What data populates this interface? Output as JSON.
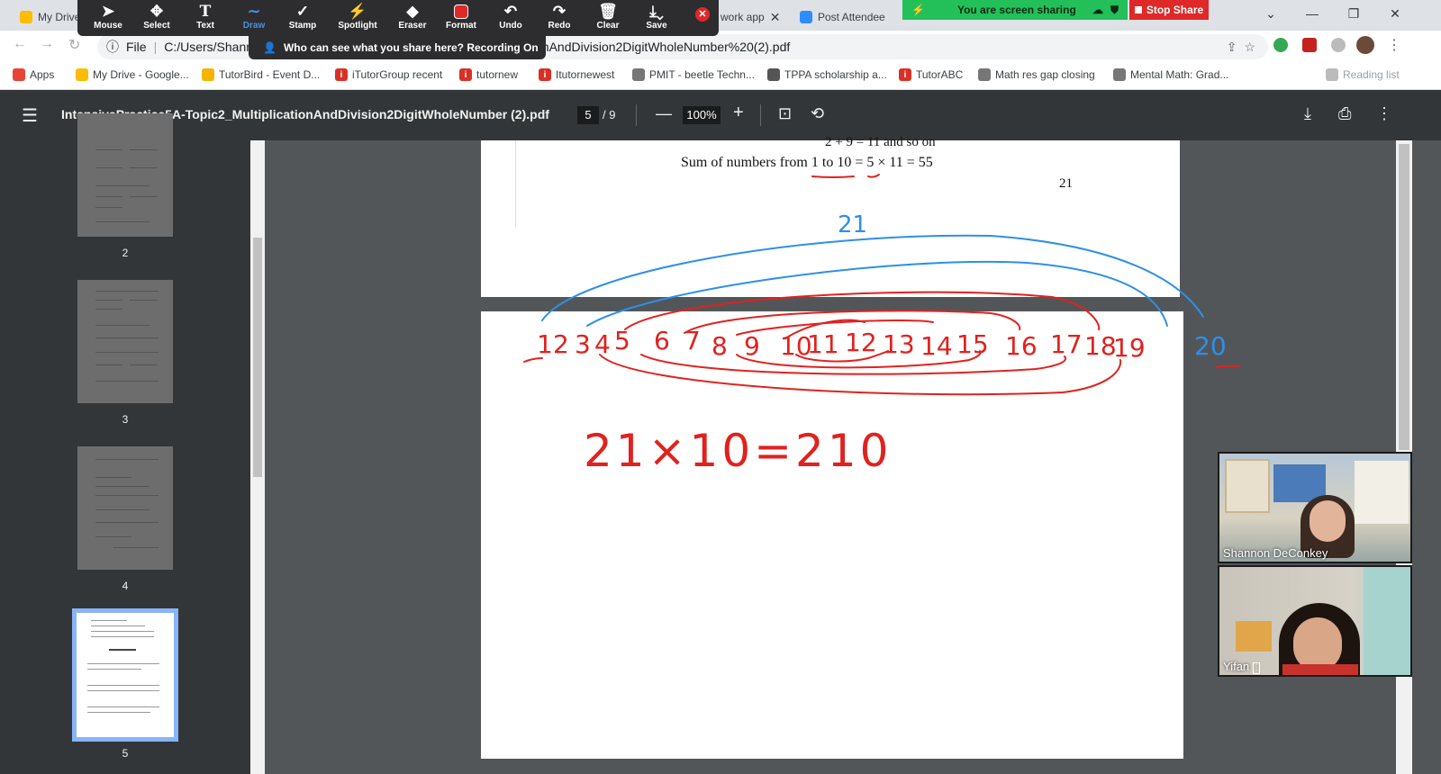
{
  "browser": {
    "tabs": [
      {
        "label": "My Drive",
        "color": "#fbbc04"
      },
      {
        "label": "work app",
        "color": "#1a73e8"
      },
      {
        "label": "Post Attendee",
        "color": "#2d8cff"
      }
    ]
  },
  "address": {
    "scheme": "File",
    "url_start": "C:/Users/Shanno",
    "url_end": "nAndDivision2DigitWholeNumber%20(2).pdf"
  },
  "bookmarks": [
    {
      "label": "Apps",
      "color": "#ea4335"
    },
    {
      "label": "My Drive - Google...",
      "color": "#fbbc04"
    },
    {
      "label": "TutorBird - Event D...",
      "color": "#f4b400"
    },
    {
      "label": "iTutorGroup recent",
      "color": "#d93025"
    },
    {
      "label": "tutornew",
      "color": "#d93025"
    },
    {
      "label": "Itutornewest",
      "color": "#d93025"
    },
    {
      "label": "PMIT - beetle Techn...",
      "color": "#777777"
    },
    {
      "label": "TPPA scholarship a...",
      "color": "#555555"
    },
    {
      "label": "TutorABC",
      "color": "#d93025"
    },
    {
      "label": "Math res gap closing",
      "color": "#777777"
    },
    {
      "label": "Mental Math: Grad...",
      "color": "#777777"
    },
    {
      "label": "Reading list",
      "color": "#777777"
    }
  ],
  "zoom_toolbar": {
    "tools": [
      "Mouse",
      "Select",
      "Text",
      "Draw",
      "Stamp",
      "Spotlight",
      "Eraser",
      "Format",
      "Undo",
      "Redo",
      "Clear",
      "Save"
    ],
    "active_tool": "Draw",
    "recording_notice": "Who can see what you share here? Recording On",
    "sharing_status": "You are screen sharing",
    "stop_share": "Stop Share"
  },
  "pdf": {
    "filename": "IntensivePractice5A-Topic2_MultiplicationAndDivision2DigitWholeNumber (2).pdf",
    "current_page": "5",
    "total_pages": "/ 9",
    "zoom": "100%",
    "thumb_labels": [
      "2",
      "3",
      "4",
      "5"
    ],
    "page_text_line1": "2 + 9   = 11 and so on",
    "page_text_line2": "Sum of numbers from 1 to 10 = 5 × 11 = 55",
    "page_number": "21"
  },
  "annotations": {
    "blue_total": "21",
    "numbers": [
      "1",
      "2",
      "3",
      "4",
      "5",
      "6",
      "7",
      "8",
      "9",
      "10",
      "11",
      "12",
      "13",
      "14",
      "15",
      "16",
      "17",
      "18",
      "19",
      "20"
    ],
    "equation": "21×10=210"
  },
  "participants": [
    {
      "name": "Shannon DeConkey"
    },
    {
      "name": "Yifan"
    }
  ],
  "colors": {
    "ink_red": "#e0221f",
    "ink_blue": "#2e8fe8",
    "pdf_toolbar": "#323639",
    "zoom_dark": "#2d2d30",
    "share_green": "#23c05a",
    "stop_red": "#e02828"
  }
}
